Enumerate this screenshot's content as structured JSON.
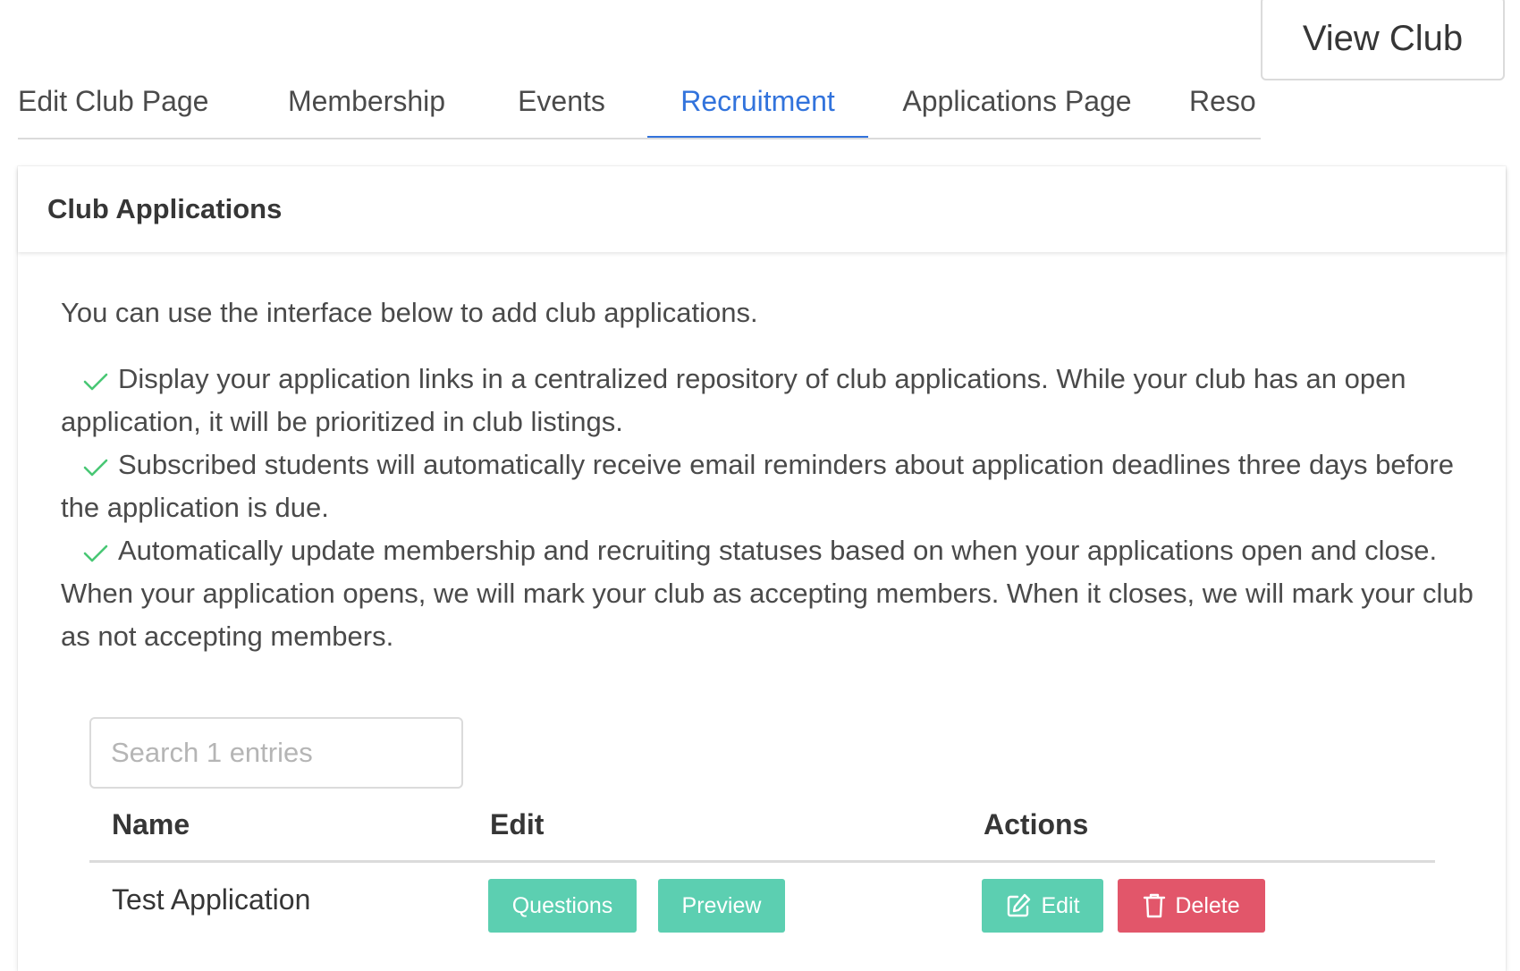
{
  "tabs": [
    {
      "label": "Edit Club Page"
    },
    {
      "label": "Membership"
    },
    {
      "label": "Events"
    },
    {
      "label": "Recruitment"
    },
    {
      "label": "Applications Page"
    },
    {
      "label": "Reso"
    }
  ],
  "active_tab": "Recruitment",
  "view_club_label": "View Club",
  "card": {
    "title": "Club Applications",
    "intro": "You can use the interface below to add club applications.",
    "features": [
      "Display your application links in a centralized repository of club applications. While your club has an open application, it will be prioritized in club listings.",
      "Subscribed students will automatically receive email reminders about application deadlines three days before the application is due.",
      "Automatically update membership and recruiting statuses based on when your applications open and close. When your application opens, we will mark your club as accepting members. When it closes, we will mark your club as not accepting members."
    ]
  },
  "search": {
    "placeholder": "Search 1 entries",
    "value": ""
  },
  "table": {
    "headers": {
      "name": "Name",
      "edit": "Edit",
      "actions": "Actions"
    },
    "rows": [
      {
        "name": "Test Application",
        "questions_label": "Questions",
        "preview_label": "Preview",
        "edit_label": "Edit",
        "delete_label": "Delete"
      }
    ]
  },
  "colors": {
    "accent": "#3273dc",
    "check": "#48c774",
    "teal_button": "#5ccfb1",
    "delete_button": "#e2566a"
  }
}
